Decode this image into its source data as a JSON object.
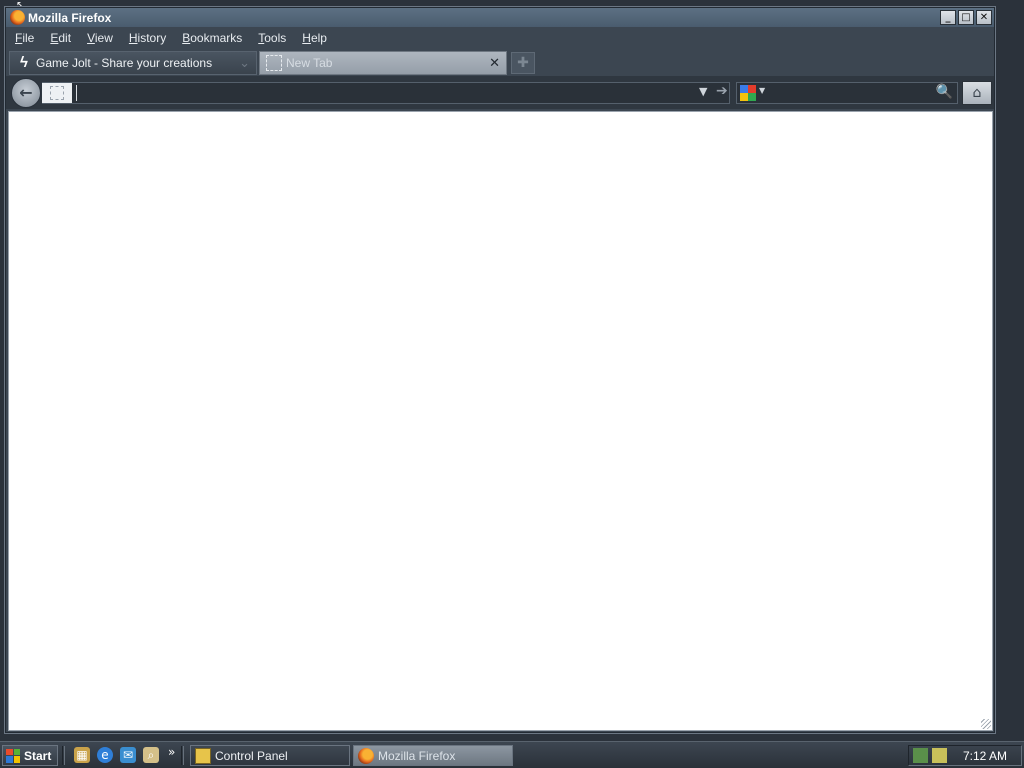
{
  "window": {
    "title": "Mozilla Firefox",
    "controls": {
      "minimize": "_",
      "maximize": "□",
      "close": "✕"
    }
  },
  "menu": {
    "items": [
      "File",
      "Edit",
      "View",
      "History",
      "Bookmarks",
      "Tools",
      "Help"
    ]
  },
  "tabs": [
    {
      "label": "Game Jolt - Share your creations",
      "icon": "game-jolt-icon",
      "active": false
    },
    {
      "label": "New Tab",
      "icon": "blank-page-icon",
      "active": true
    }
  ],
  "newtab": {
    "glyph": "✚"
  },
  "nav": {
    "back_glyph": "←",
    "url_value": "",
    "url_dropdown_glyph": "▼",
    "go_glyph": "➔",
    "search_value": "",
    "search_engine_icon": "google-icon",
    "search_glyph": "🔍",
    "home_glyph": "⌂"
  },
  "taskbar": {
    "start_label": "Start",
    "quicklaunch_more": "»",
    "tasks": [
      {
        "label": "Control Panel",
        "icon": "control-panel-icon"
      },
      {
        "label": "Mozilla Firefox",
        "icon": "firefox-icon",
        "active": true
      }
    ],
    "clock": "7:12 AM"
  },
  "colors": {
    "chrome": "#3c4651",
    "titlebar": "#5c7083",
    "active_tab": "#aeb6bf",
    "content": "#ffffff"
  }
}
